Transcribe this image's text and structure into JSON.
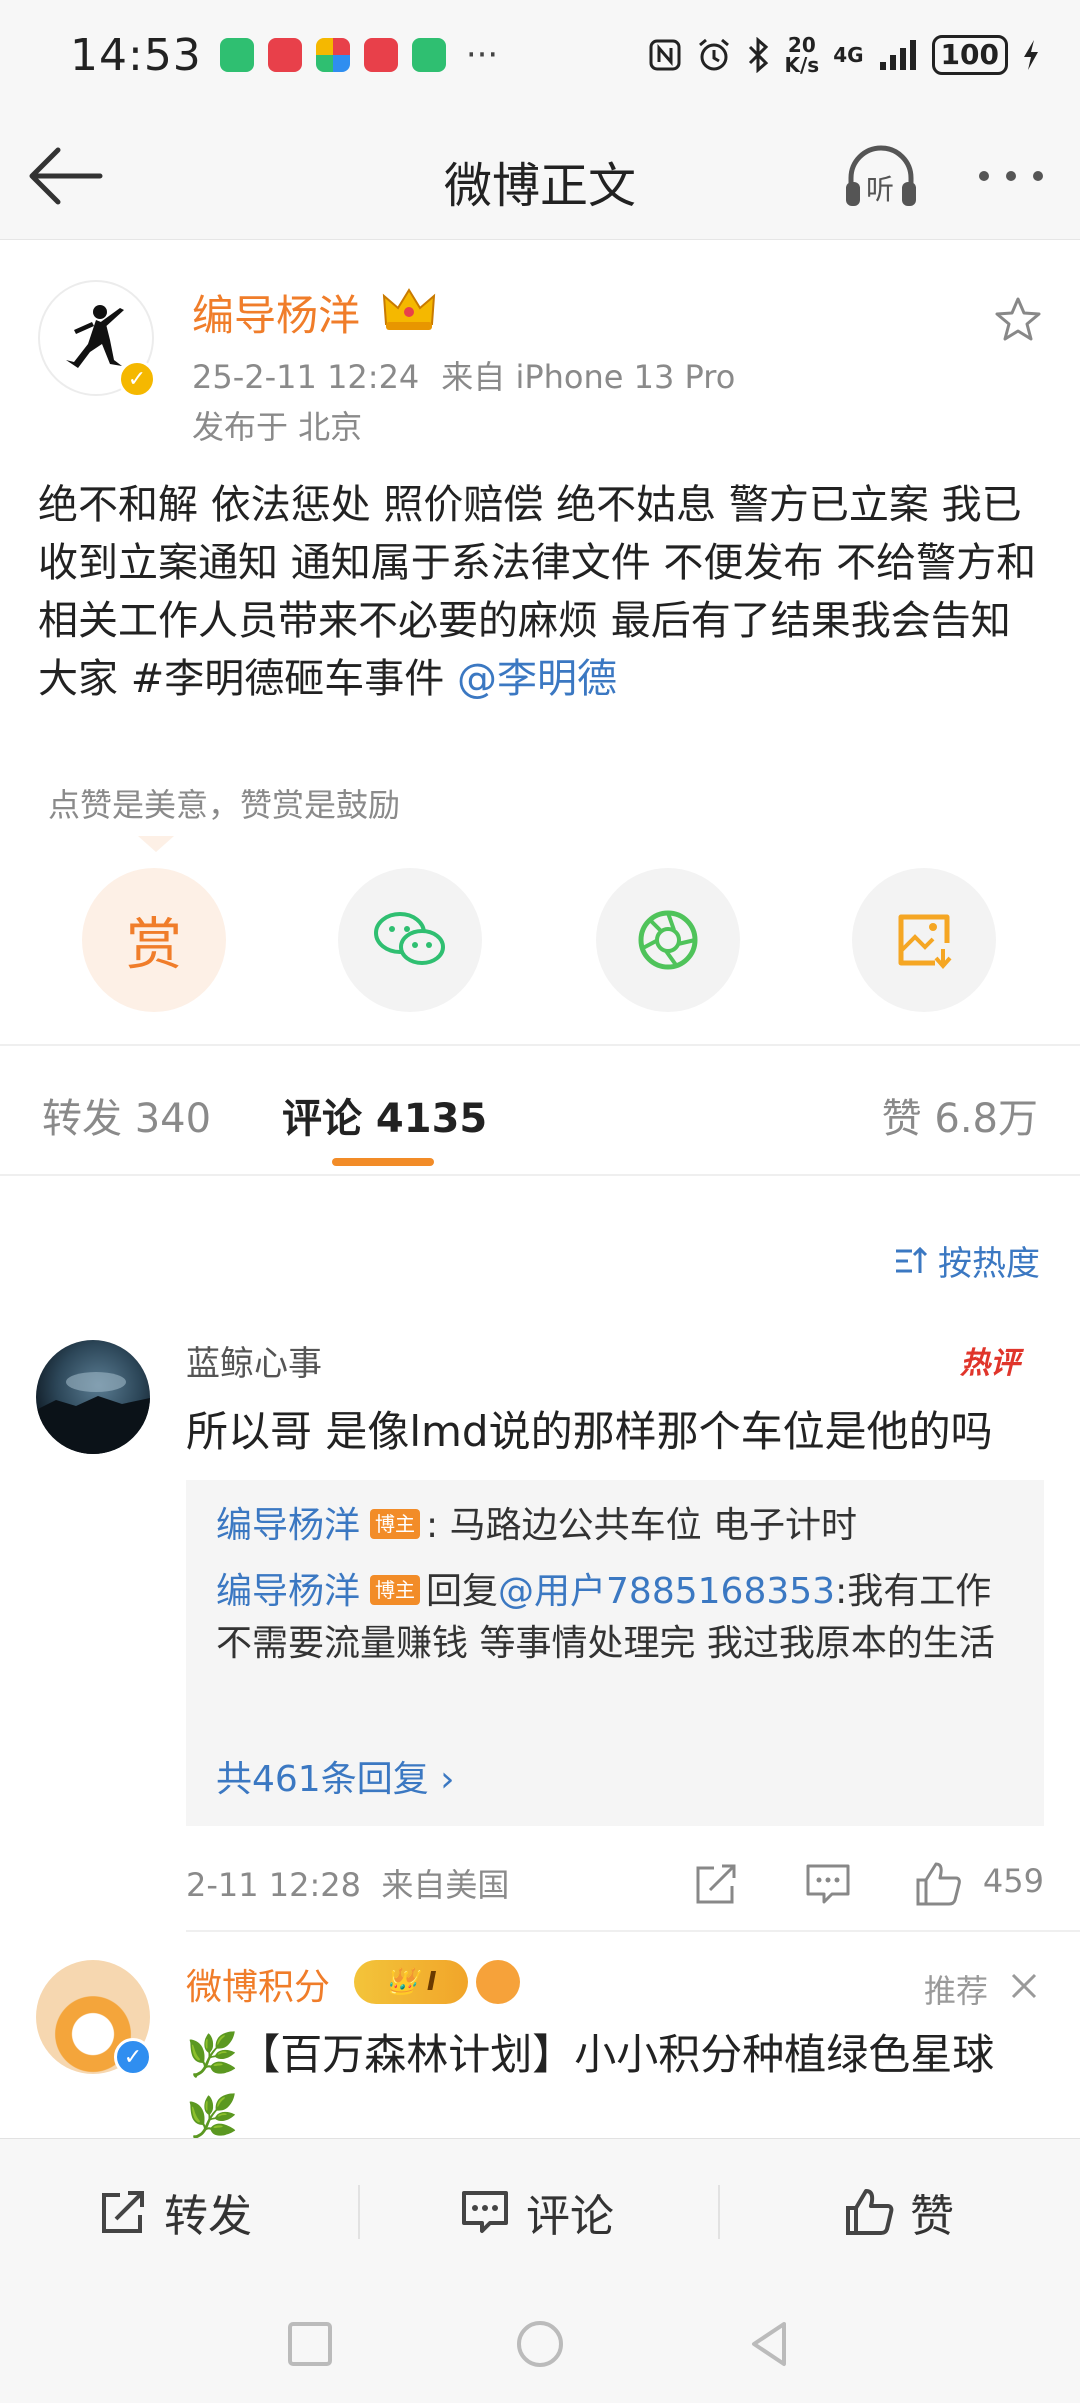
{
  "status_bar": {
    "time": "14:53",
    "more": "···",
    "net_speed_value": "20",
    "net_speed_unit": "K/s",
    "network": "4G",
    "battery": "100"
  },
  "nav": {
    "title": "微博正文",
    "listen_label": "听"
  },
  "post": {
    "author": "编导杨洋",
    "verified_mark": "✓",
    "date": "25-2-11 12:24",
    "source": "来自 iPhone 13 Pro",
    "location": "发布于 北京",
    "body_text": "绝不和解 依法惩处 照价赔偿 绝不姑息 警方已立案 我已收到立案通知 通知属于系法律文件 不便发布 不给警方和相关工作人员带来不必要的麻烦 最后有了结果我会告知大家 #李明德砸车事件 ",
    "mention": "@李明德",
    "reward_tip": "点赞是美意，赞赏是鼓励",
    "reward_label": "赏",
    "accent_color": "#f07d2a",
    "link_color": "#3b78c2"
  },
  "tabs": {
    "repost": "转发 340",
    "comments": "评论 4135",
    "likes": "赞 6.8万"
  },
  "sort_label": "按热度",
  "comment": {
    "user": "蓝鲸心事",
    "hot_tag": "热评",
    "text": "所以哥 是像lmd说的那样那个车位是他的吗",
    "replies": [
      {
        "name": "编导杨洋",
        "badge": "博主",
        "text": ": 马路边公共车位 电子计时"
      },
      {
        "name": "编导杨洋",
        "badge": "博主",
        "prefix": "回复",
        "mention": "@用户7885168353",
        "text": ":我有工作 不需要流量赚钱 等事情处理完 我过我原本的生活"
      }
    ],
    "more_replies": "共461条回复 ›",
    "time": "2-11 12:28",
    "from": "来自美国",
    "like_count": "459"
  },
  "ad": {
    "name": "微博积分",
    "level_label": "I",
    "recommend": "推荐",
    "text": "🌿【百万森林计划】小小积分种植绿色星球🌿"
  },
  "bottom_bar": {
    "repost": "转发",
    "comment": "评论",
    "like": "赞"
  }
}
